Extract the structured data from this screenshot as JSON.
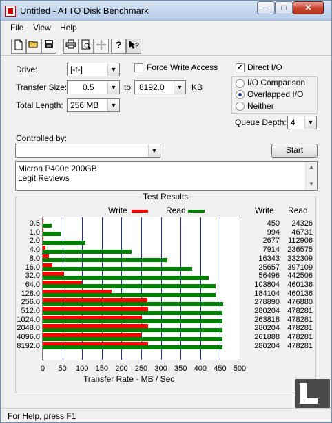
{
  "window": {
    "title": "Untitled - ATTO Disk Benchmark",
    "minimize": "─",
    "maximize": "□",
    "close": "✕"
  },
  "menu": [
    "File",
    "View",
    "Help"
  ],
  "toolbar_icons": [
    "new-file-icon",
    "open-folder-icon",
    "save-icon",
    "print-icon",
    "print-preview-icon",
    "move-icon",
    "help-icon",
    "context-help-icon"
  ],
  "drive": {
    "label": "Drive:",
    "value": "[-t-]"
  },
  "force_write_access": {
    "label": "Force Write Access",
    "checked": false
  },
  "direct_io": {
    "label": "Direct I/O",
    "checked": true
  },
  "transfer_size": {
    "label": "Transfer Size:",
    "from": "0.5",
    "to_label": "to",
    "to": "8192.0",
    "unit": "KB"
  },
  "io_mode": {
    "options": [
      "I/O Comparison",
      "Overlapped I/O",
      "Neither"
    ],
    "selected": "Overlapped I/O"
  },
  "total_length": {
    "label": "Total Length:",
    "value": "256 MB"
  },
  "queue_depth": {
    "label": "Queue Depth:",
    "value": "4"
  },
  "controlled_by": {
    "label": "Controlled by:",
    "value": ""
  },
  "start_button": "Start",
  "description": [
    "Micron P400e 200GB",
    "Legit Reviews"
  ],
  "results": {
    "title": "Test Results",
    "legend_write": "Write",
    "legend_read": "Read",
    "col_write": "Write",
    "col_read": "Read",
    "xlabel": "Transfer Rate - MB / Sec",
    "ticks": [
      "0",
      "50",
      "100",
      "150",
      "200",
      "250",
      "300",
      "350",
      "400",
      "450",
      "500"
    ]
  },
  "chart_data": {
    "type": "bar",
    "orientation": "horizontal",
    "title": "Test Results",
    "xlabel": "Transfer Rate - MB / Sec",
    "xlim": [
      0,
      500
    ],
    "grid": true,
    "categories": [
      "0.5",
      "1.0",
      "2.0",
      "4.0",
      "8.0",
      "16.0",
      "32.0",
      "64.0",
      "128.0",
      "256.0",
      "512.0",
      "1024.0",
      "2048.0",
      "4096.0",
      "8192.0"
    ],
    "series": [
      {
        "name": "Write",
        "color": "#ff0000",
        "values": [
          0.43,
          0.95,
          2.55,
          7.55,
          15.59,
          24.47,
          53.88,
          99.0,
          175.6,
          266.0,
          267.2,
          251.6,
          267.2,
          249.7,
          267.2
        ]
      },
      {
        "name": "Read",
        "color": "#008000",
        "values": [
          23.2,
          44.6,
          107.7,
          225.5,
          316.9,
          378.9,
          422.1,
          439.0,
          439.0,
          458.6,
          456.1,
          456.1,
          456.1,
          456.1,
          456.1
        ]
      }
    ],
    "write_kb": [
      "450",
      "994",
      "2677",
      "7914",
      "16343",
      "25657",
      "56496",
      "103804",
      "184104",
      "278890",
      "280204",
      "263818",
      "280204",
      "261888",
      "280204"
    ],
    "read_kb": [
      "24326",
      "46731",
      "112906",
      "236575",
      "332309",
      "397109",
      "442506",
      "460136",
      "460136",
      "476880",
      "478281",
      "478281",
      "478281",
      "478281",
      "478281"
    ]
  },
  "status": "For Help, press F1"
}
